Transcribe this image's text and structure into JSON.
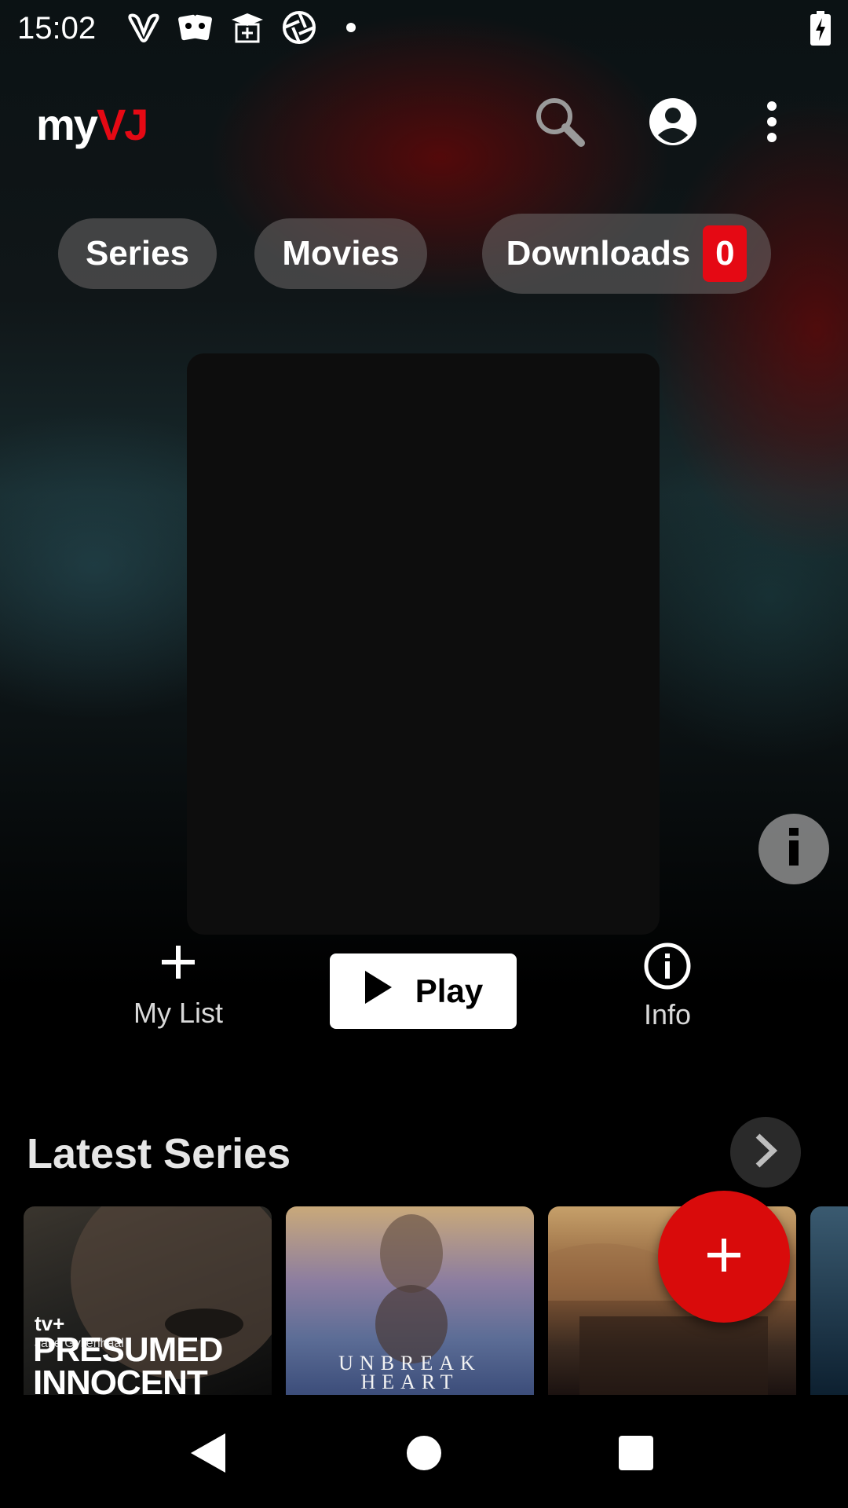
{
  "status_bar": {
    "time": "15:02",
    "icons": [
      "vivaldi-icon",
      "cards-icon",
      "graduation-icon",
      "aperture-icon",
      "dot-icon"
    ],
    "battery_icon": "battery-charging-icon"
  },
  "app_bar": {
    "logo_my": "my",
    "logo_vj": "VJ",
    "search_icon": "search-icon",
    "account_icon": "account-circle-icon",
    "menu_icon": "more-vert-icon"
  },
  "chips": {
    "series": "Series",
    "movies": "Movies",
    "downloads": "Downloads",
    "downloads_count": "0"
  },
  "actions": {
    "my_list": "My List",
    "play": "Play",
    "info": "Info"
  },
  "latest_series": {
    "title": "Latest Series",
    "cards": [
      {
        "brand": "tv+",
        "actor": "Jake Gyllenhaal",
        "title": "PRESUMED INNOCENT"
      },
      {
        "title": "UNBREAK HEART"
      },
      {
        "title": ""
      }
    ]
  },
  "colors": {
    "accent": "#e50914",
    "fab": "#d90b0b"
  }
}
